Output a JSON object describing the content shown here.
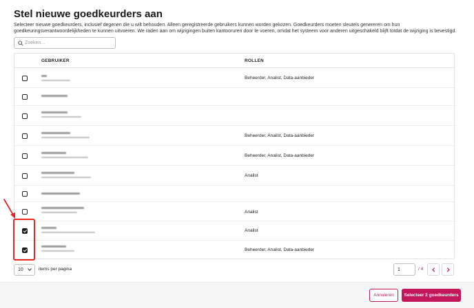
{
  "dialog": {
    "title": "Stel nieuwe goedkeurders aan",
    "description": "Selecteer nieuwe goedkeurders, inclusief degenen die u wilt behouden. Alleen geregistreerde gebruikers kunnen worden gekozen. Goedkeurders moeten sleutels genereren om hun goedkeuringsverantwoordelijkheden te kunnen uitvoeren. We raden aan om wijzigingen buiten kantooruren door te voeren, omdat het systeem voor anderen uitgeschakeld blijft totdat de wijziging is bevestigd."
  },
  "search": {
    "placeholder": "Zoeken..."
  },
  "table": {
    "columns": {
      "user": "GEBRUIKER",
      "roles": "ROLLEN"
    },
    "rows": [
      {
        "checked": false,
        "roles": "Beheerder, Analist, Data-aanbieder"
      },
      {
        "checked": false,
        "roles": ""
      },
      {
        "checked": false,
        "roles": ""
      },
      {
        "checked": false,
        "roles": "Beheerder, Analist, Data-aanbieder"
      },
      {
        "checked": false,
        "roles": "Beheerder, Analist, Data-aanbieder"
      },
      {
        "checked": false,
        "roles": "Analist"
      },
      {
        "checked": false,
        "roles": ""
      },
      {
        "checked": false,
        "roles": "Analist"
      },
      {
        "checked": true,
        "roles": "Analist"
      },
      {
        "checked": true,
        "roles": "Beheerder, Analist, Data-aanbieder"
      }
    ]
  },
  "pagination": {
    "page_size": "10",
    "items_per_page_label": "items per pagina",
    "current_page": "1",
    "total_label": "/ 4"
  },
  "footer": {
    "cancel_label": "Annuleren",
    "confirm_label": "Selecteer 2 goedkeurders"
  },
  "colors": {
    "accent": "#c2185b",
    "annotation": "#e8261f"
  }
}
